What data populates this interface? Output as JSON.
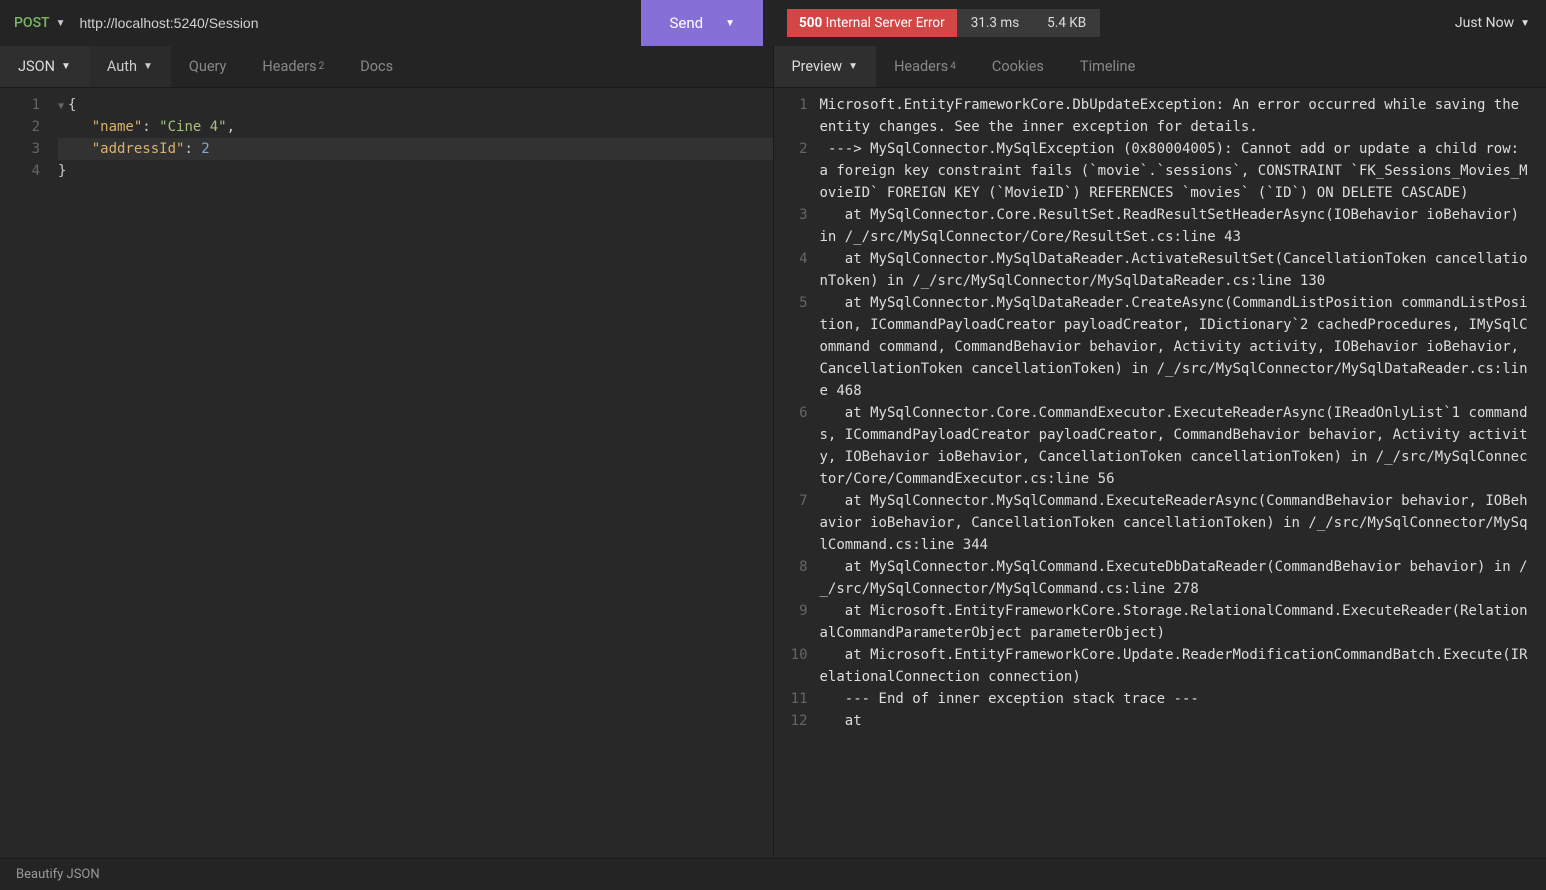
{
  "request": {
    "method": "POST",
    "url": "http://localhost:5240/Session",
    "send_label": "Send"
  },
  "left_tabs": {
    "body_type": "JSON",
    "auth": "Auth",
    "query": "Query",
    "headers": "Headers",
    "headers_count": "2",
    "docs": "Docs"
  },
  "request_body": {
    "code_lines": [
      {
        "n": "1",
        "raw": "{",
        "fold": true
      },
      {
        "n": "2",
        "raw": "    \"name\": \"Cine 4\","
      },
      {
        "n": "3",
        "raw": "    \"addressId\": 2"
      },
      {
        "n": "4",
        "raw": "}"
      }
    ],
    "json_key_name": "\"name\"",
    "json_val_name": "\"Cine 4\"",
    "json_key_addr": "\"addressId\"",
    "json_val_addr": "2"
  },
  "response": {
    "status_code": "500",
    "status_text": "Internal Server Error",
    "time": "31.3 ms",
    "size": "5.4 KB",
    "when": "Just Now"
  },
  "right_tabs": {
    "preview": "Preview",
    "headers": "Headers",
    "headers_count": "4",
    "cookies": "Cookies",
    "timeline": "Timeline"
  },
  "response_body": [
    {
      "n": "1",
      "t": "Microsoft.EntityFrameworkCore.DbUpdateException: An error occurred while saving the entity changes. See the inner exception for details."
    },
    {
      "n": "2",
      "t": " ---> MySqlConnector.MySqlException (0x80004005): Cannot add or update a child row: a foreign key constraint fails (`movie`.`sessions`, CONSTRAINT `FK_Sessions_Movies_MovieID` FOREIGN KEY (`MovieID`) REFERENCES `movies` (`ID`) ON DELETE CASCADE)"
    },
    {
      "n": "3",
      "t": "   at MySqlConnector.Core.ResultSet.ReadResultSetHeaderAsync(IOBehavior ioBehavior) in /_/src/MySqlConnector/Core/ResultSet.cs:line 43"
    },
    {
      "n": "4",
      "t": "   at MySqlConnector.MySqlDataReader.ActivateResultSet(CancellationToken cancellationToken) in /_/src/MySqlConnector/MySqlDataReader.cs:line 130"
    },
    {
      "n": "5",
      "t": "   at MySqlConnector.MySqlDataReader.CreateAsync(CommandListPosition commandListPosition, ICommandPayloadCreator payloadCreator, IDictionary`2 cachedProcedures, IMySqlCommand command, CommandBehavior behavior, Activity activity, IOBehavior ioBehavior, CancellationToken cancellationToken) in /_/src/MySqlConnector/MySqlDataReader.cs:line 468"
    },
    {
      "n": "6",
      "t": "   at MySqlConnector.Core.CommandExecutor.ExecuteReaderAsync(IReadOnlyList`1 commands, ICommandPayloadCreator payloadCreator, CommandBehavior behavior, Activity activity, IOBehavior ioBehavior, CancellationToken cancellationToken) in /_/src/MySqlConnector/Core/CommandExecutor.cs:line 56"
    },
    {
      "n": "7",
      "t": "   at MySqlConnector.MySqlCommand.ExecuteReaderAsync(CommandBehavior behavior, IOBehavior ioBehavior, CancellationToken cancellationToken) in /_/src/MySqlConnector/MySqlCommand.cs:line 344"
    },
    {
      "n": "8",
      "t": "   at MySqlConnector.MySqlCommand.ExecuteDbDataReader(CommandBehavior behavior) in /_/src/MySqlConnector/MySqlCommand.cs:line 278"
    },
    {
      "n": "9",
      "t": "   at Microsoft.EntityFrameworkCore.Storage.RelationalCommand.ExecuteReader(RelationalCommandParameterObject parameterObject)"
    },
    {
      "n": "10",
      "t": "   at Microsoft.EntityFrameworkCore.Update.ReaderModificationCommandBatch.Execute(IRelationalConnection connection)"
    },
    {
      "n": "11",
      "t": "   --- End of inner exception stack trace ---"
    },
    {
      "n": "12",
      "t": "   at"
    }
  ],
  "footer": {
    "beautify": "Beautify JSON"
  }
}
